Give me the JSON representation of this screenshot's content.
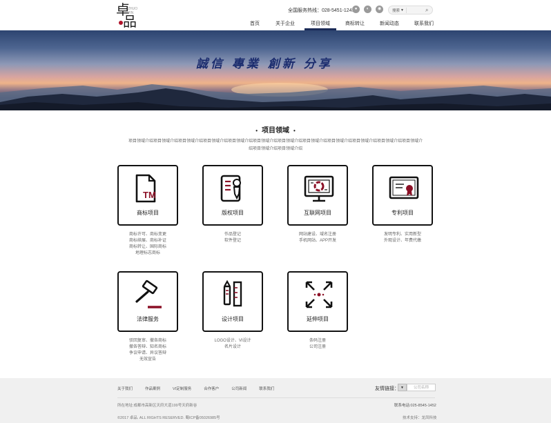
{
  "header": {
    "logo_chars": [
      "卓",
      "品"
    ],
    "logo_mini": "ZHUO PIN",
    "hotline": "全国服务热线：028-5451-1241",
    "social_icons": [
      "user-icon",
      "wechat-icon",
      "weibo-icon"
    ],
    "search": {
      "select_label": "搜索",
      "placeholder": "",
      "icon": "search-icon"
    }
  },
  "nav": {
    "items": [
      {
        "label": "首页",
        "active": false
      },
      {
        "label": "关于企业",
        "active": false
      },
      {
        "label": "项目领域",
        "active": true
      },
      {
        "label": "商标转让",
        "active": false
      },
      {
        "label": "新闻动态",
        "active": false
      },
      {
        "label": "联系我们",
        "active": false
      }
    ],
    "active_color": "#1a2a57"
  },
  "banner": {
    "slogan": "誠信 專業 創新 分享"
  },
  "section": {
    "title": "项目领域",
    "bullet": "•",
    "intro": "项目领域介绍项目领域介绍项目领域介绍项目领域介绍项目领域介绍项目领域介绍项目领域介绍项目领域介绍项目领域介绍项目领域介绍项目领域介绍项目领域介绍项目领域介绍项目领域介绍"
  },
  "services": [
    {
      "label": "商标项目",
      "icon": "trademark-icon",
      "desc": [
        "商标许可、商标变更",
        "商标续展、商标补证",
        "商标转让、国际商标",
        "地理标志商标"
      ]
    },
    {
      "label": "版权项目",
      "icon": "copyright-icon",
      "desc": [
        "作品登记",
        "软件登记"
      ]
    },
    {
      "label": "互联网项目",
      "icon": "monitor-icon",
      "desc": [
        "网站建设、域名注册",
        "手机网站、APP开发"
      ]
    },
    {
      "label": "专利项目",
      "icon": "certificate-icon",
      "desc": [
        "发明专利、实用新型",
        "外观设计、年费代缴"
      ]
    },
    {
      "label": "法律服务",
      "icon": "gavel-icon",
      "desc": [
        "驳回复审、撤各商标",
        "撤各答辩、知名商标",
        "争议申请、异议答辩",
        "无效宣告"
      ]
    },
    {
      "label": "设计项目",
      "icon": "design-icon",
      "desc": [
        "LOGO设计、VI设计",
        "名片设计"
      ]
    },
    {
      "label": "延伸项目",
      "icon": "expand-icon",
      "desc": [
        "条码注册",
        "公司注册"
      ]
    }
  ],
  "footer": {
    "links": [
      "关于我们",
      "作品案例",
      "VI定制服务",
      "合作客户",
      "公司新闻",
      "联系我们"
    ],
    "friend_links_label": "友情链接：",
    "friend_links_dropdown": "▼",
    "friend_links_value": "公司名称",
    "address": "所在地址:成都市高新区天府大道199号天府新谷",
    "phone": "联系电话:025-8545-1452",
    "copyright": "©2017 卓品. ALL RIGHTS RESERVED. 蜀ICP备05026985号",
    "tech_support": "技术支持：龙凤科技"
  }
}
